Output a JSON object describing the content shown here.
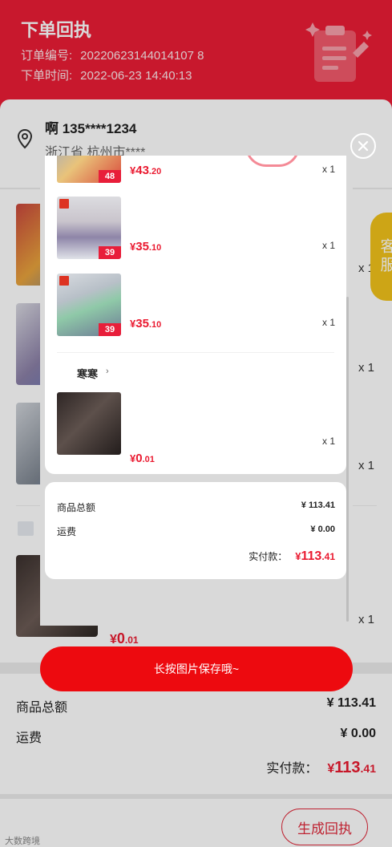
{
  "header": {
    "title": "下单回执",
    "order_no_label": "订单编号:",
    "order_no": "20220623144014107 8",
    "order_time_label": "下单时间:",
    "order_time": "2022-06-23 14:40:13"
  },
  "address": {
    "name_phone": "啊 135****1234",
    "detail": "浙江省 杭州市****"
  },
  "background_items": {
    "qty": [
      "x 1",
      "x 1",
      "x 1",
      "x 1"
    ],
    "last_price": {
      "symbol": "¥",
      "int": "0",
      "dec": ".01"
    }
  },
  "kefu": {
    "label": "客服"
  },
  "summary": {
    "goods_total_label": "商品总额",
    "goods_total": "¥ 113.41",
    "shipping_label": "运费",
    "shipping": "¥ 0.00",
    "paid_label": "实付款：",
    "paid": {
      "symbol": "¥",
      "int": "113",
      "dec": ".41"
    }
  },
  "bottom": {
    "generate_button": "生成回执",
    "watermark": "大数跨境"
  },
  "modal": {
    "items": [
      {
        "price": {
          "symbol": "¥",
          "int": "43",
          "dec": ".20"
        },
        "qty": "x 1",
        "badge": "48"
      },
      {
        "price": {
          "symbol": "¥",
          "int": "35",
          "dec": ".10"
        },
        "qty": "x 1",
        "badge": "39"
      },
      {
        "price": {
          "symbol": "¥",
          "int": "35",
          "dec": ".10"
        },
        "qty": "x 1",
        "badge": "39"
      },
      {
        "price": {
          "symbol": "¥",
          "int": "0",
          "dec": ".01"
        },
        "qty": "x 1",
        "badge": ""
      }
    ],
    "shop_name": "寒寒",
    "shop_arrow": "›",
    "goods_total_label": "商品总额",
    "goods_total": "¥ 113.41",
    "shipping_label": "运费",
    "shipping": "¥ 0.00",
    "paid_label": "实付款：",
    "paid": {
      "symbol": "¥",
      "int": "113",
      "dec": ".41"
    },
    "save_button": "长按图片保存哦~"
  },
  "colors": {
    "brand_red": "#ec1d36",
    "price_red": "#ea1a30",
    "save_button": "#ed0a0f",
    "kefu_yellow": "#f1c21b"
  }
}
